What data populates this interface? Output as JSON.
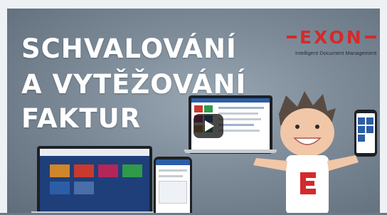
{
  "video": {
    "headline_lines": [
      "SCHVALOVÁNÍ",
      "A VYTĚŽOVÁNÍ",
      "FAKTUR"
    ]
  },
  "logo": {
    "word": "EXON",
    "tagline": "Intelligent Document Management"
  },
  "colors": {
    "brand_red": "#d42a2a",
    "tile_orange": "#d0862b",
    "tile_red": "#c83a2e",
    "tile_magenta": "#b3265a",
    "tile_green": "#2f9a4a",
    "tile_blue": "#2c5ea6",
    "dark_ui": "#1f3f7a"
  },
  "icons": {
    "play": "play-icon"
  }
}
